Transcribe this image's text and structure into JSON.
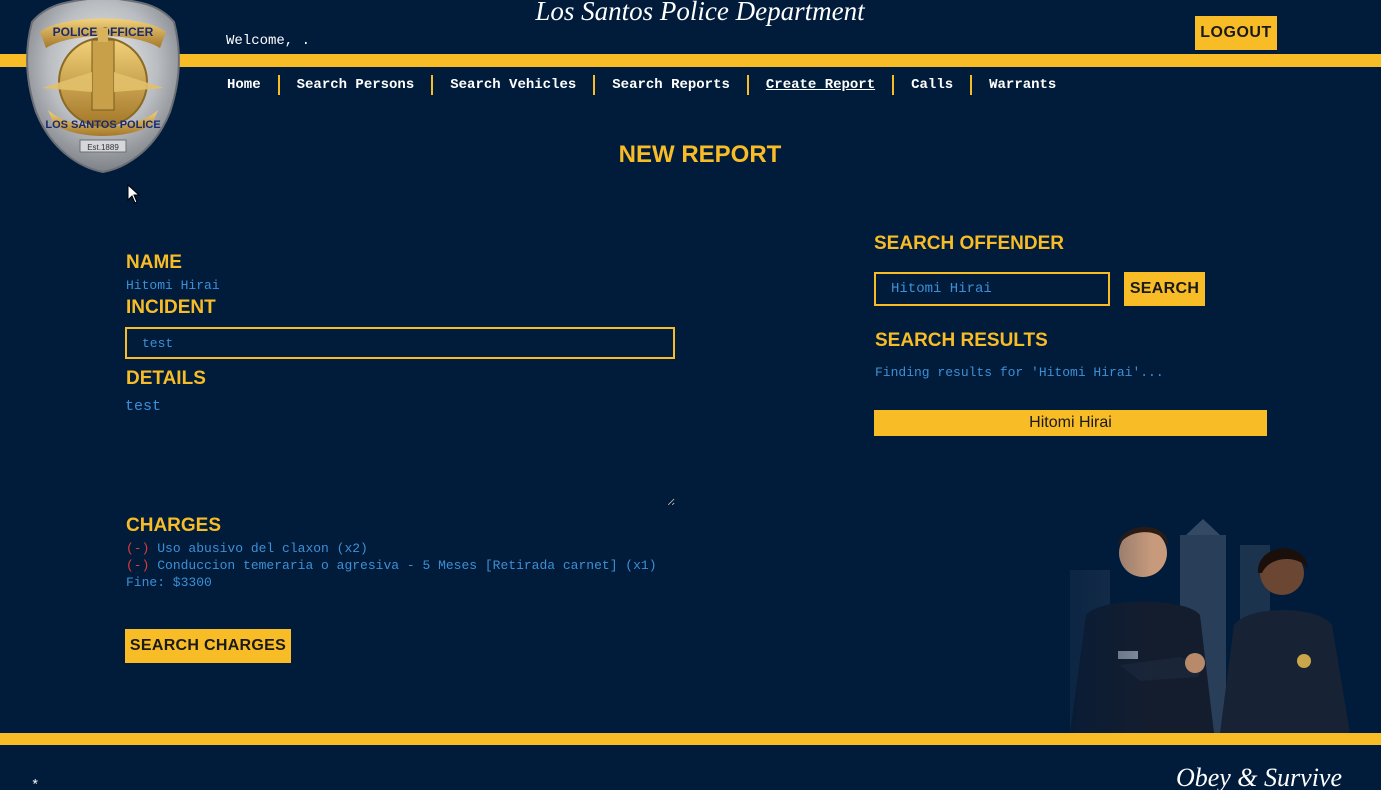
{
  "header": {
    "title": "Los Santos Police Department",
    "welcome": "Welcome, .",
    "logout_label": "LOGOUT",
    "badge": {
      "top_text": "POLICE OFFICER",
      "bottom_text": "LOS SANTOS POLICE",
      "est": "Est.1889"
    }
  },
  "nav": {
    "items": [
      {
        "label": "Home"
      },
      {
        "label": "Search Persons"
      },
      {
        "label": "Search Vehicles"
      },
      {
        "label": "Search Reports"
      },
      {
        "label": "Create Report",
        "active": true
      },
      {
        "label": "Calls"
      },
      {
        "label": "Warrants"
      }
    ]
  },
  "page": {
    "heading": "NEW REPORT"
  },
  "report": {
    "name_label": "NAME",
    "name_value": "Hitomi Hirai",
    "incident_label": "INCIDENT",
    "incident_value": "test",
    "details_label": "DETAILS",
    "details_value": "test",
    "charges_label": "CHARGES",
    "remove_symbol": "(-)",
    "charges": [
      {
        "text": "Uso abusivo del claxon (x2)"
      },
      {
        "text": "Conduccion temeraria o agresiva - 5 Meses [Retirada carnet] (x1)"
      }
    ],
    "fine": "Fine: $3300",
    "search_charges_label": "SEARCH CHARGES"
  },
  "offender": {
    "heading": "SEARCH OFFENDER",
    "input_value": "Hitomi Hirai",
    "search_label": "SEARCH",
    "results_heading": "SEARCH RESULTS",
    "finding_text": "Finding results for 'Hitomi Hirai'...",
    "results": [
      {
        "name": "Hitomi Hirai"
      }
    ]
  },
  "footer": {
    "star": "*",
    "motto": "Obey & Survive"
  },
  "colors": {
    "background": "#011c3b",
    "accent": "#f8bc27",
    "value_text": "#3d8fd6",
    "remove": "#e03a3a"
  }
}
